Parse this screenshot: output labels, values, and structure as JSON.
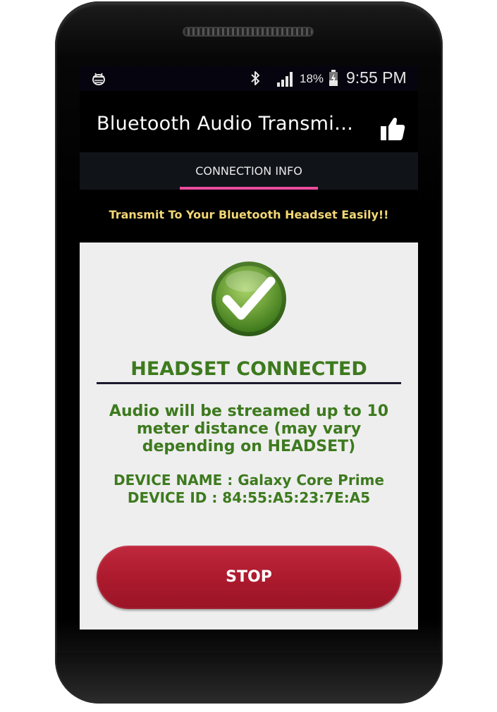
{
  "status_bar": {
    "notification_icon": "android-bug-icon",
    "bluetooth_icon": "bluetooth-icon",
    "signal_icon": "signal-bars-icon",
    "battery_percent": "18%",
    "battery_icon": "battery-charging-icon",
    "time": "9:55 PM"
  },
  "action_bar": {
    "title": "Bluetooth Audio Transmi…",
    "like_icon": "thumbs-up-icon"
  },
  "tabs": [
    {
      "label": "CONNECTION INFO",
      "selected": true,
      "indicator_color": "#ea4c9d"
    }
  ],
  "tagline": "Transmit To Your Bluetooth Headset Easily!!",
  "main": {
    "status_icon": "green-checkmark-icon",
    "headline": "HEADSET CONNECTED",
    "info": "Audio will be streamed up to 10 meter distance (may vary depending on HEADSET)",
    "device_name": "DEVICE NAME : Galaxy Core Prime",
    "device_id": "DEVICE ID : 84:55:A5:23:7E:A5",
    "stop_label": "STOP"
  },
  "colors": {
    "accent_green": "#3d7a1e",
    "tagline_yellow": "#f2d775",
    "stop_red": "#ad1a2e",
    "tab_indicator": "#ea4c9d"
  }
}
